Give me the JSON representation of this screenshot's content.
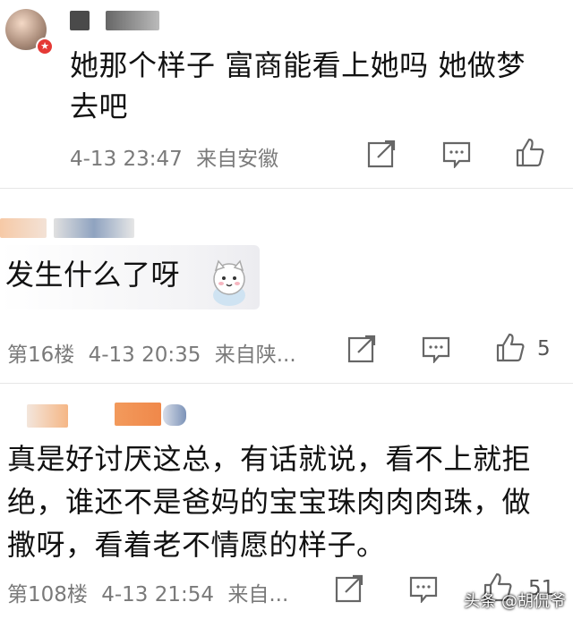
{
  "comments": [
    {
      "text_line1": "她那个样子 富商能看上她吗 她做梦",
      "text_line2": "去吧",
      "datetime": "4-13 23:47",
      "location": "来自安徽",
      "icons": [
        "share-icon",
        "reply-icon",
        "like-icon"
      ]
    },
    {
      "text": "发生什么了呀",
      "floor": "第16楼",
      "datetime": "4-13 20:35",
      "location": "来自陕...",
      "likes": "5",
      "icons": [
        "share-icon",
        "reply-icon",
        "like-icon"
      ]
    },
    {
      "text_line1": "真是好讨厌这总，有话就说，看不上就拒",
      "text_line2": "绝，谁还不是爸妈的宝宝珠肉肉肉珠，做",
      "text_line3": "撒呀，看着老不情愿的样子。",
      "floor": "第108楼",
      "datetime": "4-13 21:54",
      "location": "来自...",
      "likes": "51",
      "icons": [
        "share-icon",
        "reply-icon",
        "like-icon"
      ]
    }
  ],
  "watermark": "头条 @胡侃爷",
  "colors": {
    "meta_text": "#7a7a7a",
    "divider": "#e6e6e6",
    "badge_red": "#e53935"
  }
}
